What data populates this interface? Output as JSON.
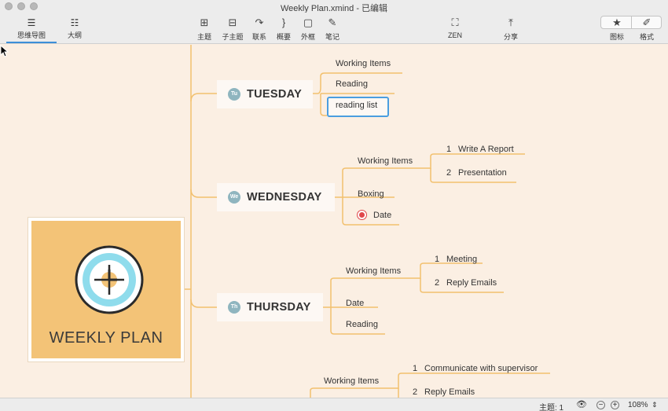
{
  "window": {
    "title": "Weekly Plan.xmind - 已编辑"
  },
  "toolbar": {
    "view_tabs": [
      {
        "label": "思维导图",
        "icon": "mindmap-view-icon"
      },
      {
        "label": "大纲",
        "icon": "outline-view-icon"
      }
    ],
    "tools": [
      {
        "label": "主题",
        "icon": "topic-icon"
      },
      {
        "label": "子主题",
        "icon": "subtopic-icon"
      },
      {
        "label": "联系",
        "icon": "relationship-icon"
      },
      {
        "label": "概要",
        "icon": "summary-icon"
      },
      {
        "label": "外框",
        "icon": "boundary-icon"
      },
      {
        "label": "笔记",
        "icon": "note-icon"
      },
      {
        "label": "ZEN",
        "icon": "zen-icon"
      },
      {
        "label": "分享",
        "icon": "share-icon"
      }
    ],
    "panel_buttons": [
      {
        "label": "图标",
        "icon": "star-icon"
      },
      {
        "label": "格式",
        "icon": "brush-icon"
      }
    ]
  },
  "mindmap": {
    "central": {
      "title": "WEEKLY PLAN",
      "icon": "clock-icon",
      "color": "#f3c377"
    },
    "line_color": "#f2c06e",
    "days": [
      {
        "badge": "Tu",
        "label": "TUESDAY",
        "items": [
          "Working Items",
          "Reading",
          "reading list"
        ]
      },
      {
        "badge": "We",
        "label": "WEDNESDAY",
        "items": [
          "Working Items",
          "Boxing",
          "Date"
        ],
        "sub_items": [
          {
            "num": "1",
            "label": "Write A Report"
          },
          {
            "num": "2",
            "label": "Presentation"
          }
        ]
      },
      {
        "badge": "Th",
        "label": "THURSDAY",
        "items": [
          "Working Items",
          "Date",
          "Reading"
        ],
        "sub_items": [
          {
            "num": "1",
            "label": "Meeting"
          },
          {
            "num": "2",
            "label": "Reply Emails"
          }
        ]
      },
      {
        "items": [
          "Working Items"
        ],
        "sub_items": [
          {
            "num": "1",
            "label": "Communicate with supervisor"
          },
          {
            "num": "2",
            "label": "Reply Emails"
          }
        ]
      }
    ]
  },
  "status": {
    "topic_count": "主题: 1",
    "zoom": "108%"
  }
}
